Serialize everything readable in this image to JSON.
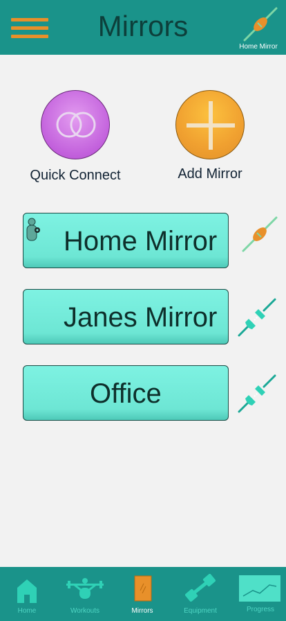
{
  "header": {
    "title": "Mirrors",
    "active_mirror_caption": "Home Mirror"
  },
  "actions": {
    "quick_connect_label": "Quick Connect",
    "add_mirror_label": "Add Mirror"
  },
  "mirrors": [
    {
      "name": "Home Mirror",
      "connected": true
    },
    {
      "name": "Janes Mirror",
      "connected": false
    },
    {
      "name": "Office",
      "connected": false
    }
  ],
  "tabbar": {
    "tabs": [
      {
        "label": "Home",
        "icon": "house-icon",
        "active": false
      },
      {
        "label": "Workouts",
        "icon": "weightlifter-icon",
        "active": false
      },
      {
        "label": "Mirrors",
        "icon": "mirror-icon",
        "active": true
      },
      {
        "label": "Equipment",
        "icon": "dumbbell-icon",
        "active": false
      },
      {
        "label": "Progress",
        "icon": "chart-icon",
        "active": false
      }
    ]
  },
  "colors": {
    "header_bg": "#1a938a",
    "accent_orange": "#e8902a",
    "mirror_card": "#7ef2e2",
    "quick_connect": "#c260dc",
    "add_mirror": "#f0a030"
  }
}
